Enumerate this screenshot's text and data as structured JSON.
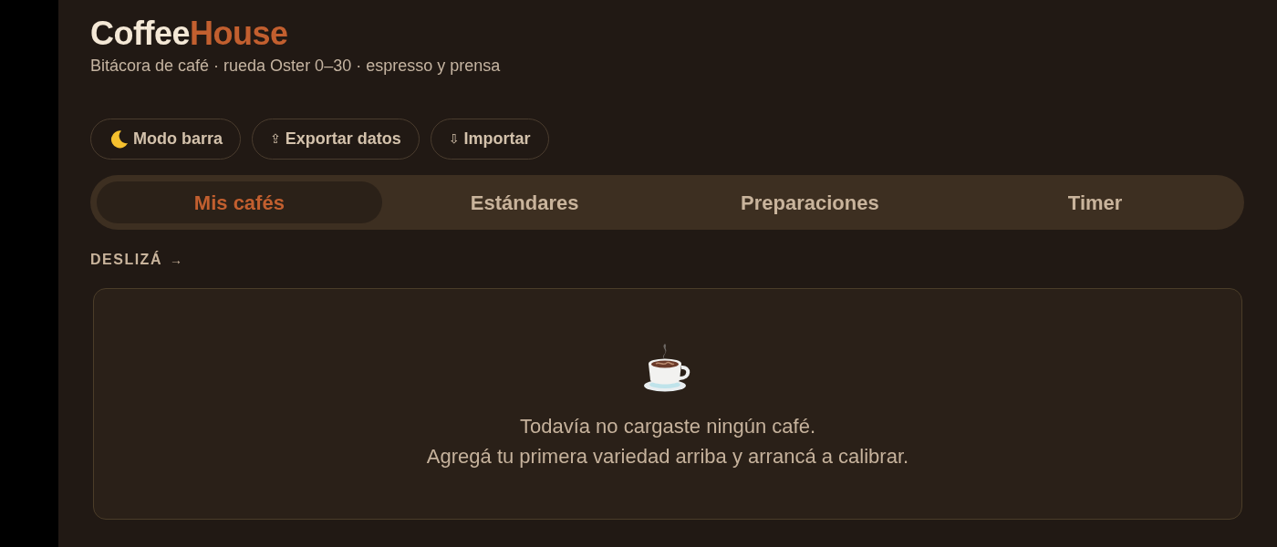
{
  "header": {
    "title": [
      {
        "text": "Coffee",
        "accent": false
      },
      {
        "text": "House",
        "accent": true
      }
    ],
    "subtitle": "Bitácora de café · rueda Oster 0–30 · espresso y prensa"
  },
  "actions": [
    {
      "kind": "moon",
      "label": "Modo barra"
    },
    {
      "kind": "glyph",
      "glyph": "⇪",
      "label": "Exportar datos"
    },
    {
      "kind": "glyph",
      "glyph": "⇩",
      "label": "Importar"
    }
  ],
  "tabs": [
    {
      "label": "Mis cafés",
      "selected": true
    },
    {
      "label": "Estándares",
      "selected": false
    },
    {
      "label": "Preparaciones",
      "selected": false
    },
    {
      "label": "Timer",
      "selected": false
    }
  ],
  "swipe_hint": {
    "label": "DESLIZÁ",
    "arrow": "→"
  },
  "empty_state": {
    "lines": [
      "Todavía no cargaste ningún café.",
      "Agregá tu primera variedad arriba y arrancá a calibrar."
    ]
  }
}
